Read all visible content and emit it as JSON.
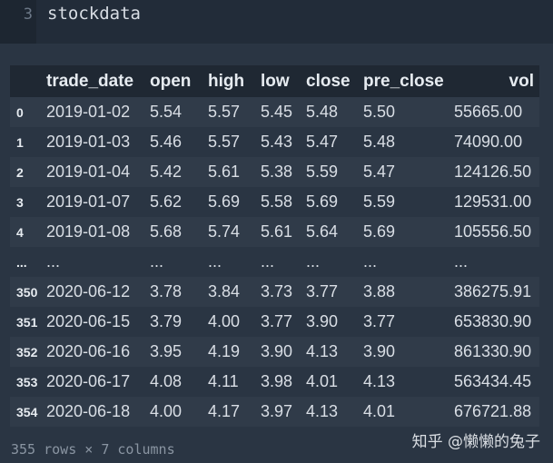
{
  "cell": {
    "line_number": "3",
    "code": "stockdata"
  },
  "dataframe": {
    "columns": [
      "trade_date",
      "open",
      "high",
      "low",
      "close",
      "pre_close",
      "vol"
    ],
    "rows": [
      {
        "index": "0",
        "values": [
          "2019-01-02",
          "5.54",
          "5.57",
          "5.45",
          "5.48",
          "5.50",
          "55665.00"
        ]
      },
      {
        "index": "1",
        "values": [
          "2019-01-03",
          "5.46",
          "5.57",
          "5.43",
          "5.47",
          "5.48",
          "74090.00"
        ]
      },
      {
        "index": "2",
        "values": [
          "2019-01-04",
          "5.42",
          "5.61",
          "5.38",
          "5.59",
          "5.47",
          "124126.50"
        ]
      },
      {
        "index": "3",
        "values": [
          "2019-01-07",
          "5.62",
          "5.69",
          "5.58",
          "5.69",
          "5.59",
          "129531.00"
        ]
      },
      {
        "index": "4",
        "values": [
          "2019-01-08",
          "5.68",
          "5.74",
          "5.61",
          "5.64",
          "5.69",
          "105556.50"
        ]
      },
      {
        "index": "...",
        "values": [
          "...",
          "...",
          "...",
          "...",
          "...",
          "...",
          "..."
        ]
      },
      {
        "index": "350",
        "values": [
          "2020-06-12",
          "3.78",
          "3.84",
          "3.73",
          "3.77",
          "3.88",
          "386275.91"
        ]
      },
      {
        "index": "351",
        "values": [
          "2020-06-15",
          "3.79",
          "4.00",
          "3.77",
          "3.90",
          "3.77",
          "653830.90"
        ]
      },
      {
        "index": "352",
        "values": [
          "2020-06-16",
          "3.95",
          "4.19",
          "3.90",
          "4.13",
          "3.90",
          "861330.90"
        ]
      },
      {
        "index": "353",
        "values": [
          "2020-06-17",
          "4.08",
          "4.11",
          "3.98",
          "4.01",
          "4.13",
          "563434.45"
        ]
      },
      {
        "index": "354",
        "values": [
          "2020-06-18",
          "4.00",
          "4.17",
          "3.97",
          "4.13",
          "4.01",
          "676721.88"
        ]
      }
    ],
    "shape": "355 rows × 7 columns"
  },
  "watermark": "知乎 @懒懒的兔子"
}
